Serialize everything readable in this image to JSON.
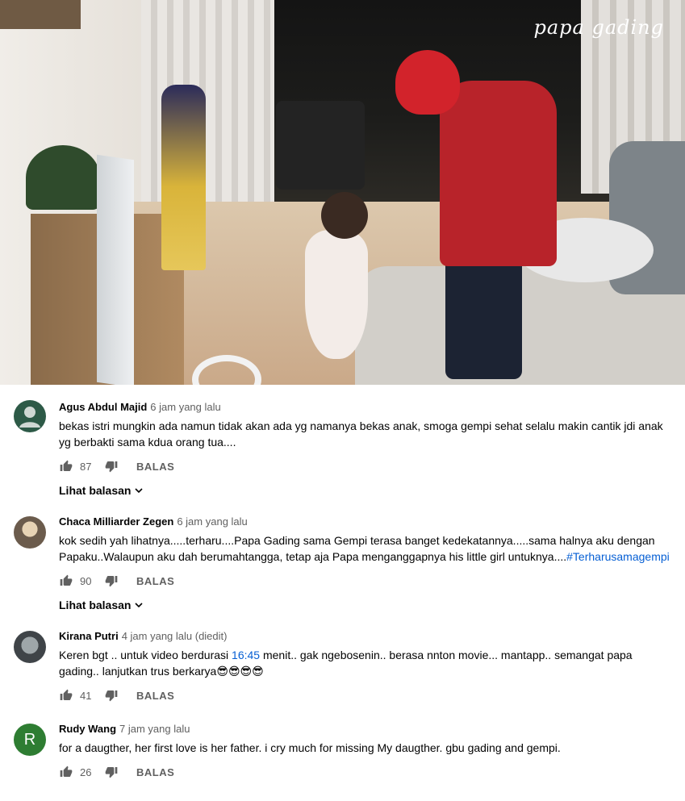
{
  "video": {
    "watermark": "papa gading"
  },
  "comments": [
    {
      "author": "Agus Abdul Majid",
      "time": "6 jam yang lalu",
      "avatar": "default-user-icon",
      "text_lines": [
        "bekas istri mungkin ada namun tidak akan ada yg namanya bekas anak, smoga gempi sehat selalu makin cantik jdi anak",
        "yg berbakti sama kdua orang tua...."
      ],
      "likes": "87",
      "reply_label": "BALAS",
      "replies_label": "Lihat balasan"
    },
    {
      "author": "Chaca Milliarder Zegen",
      "time": "6 jam yang lalu",
      "avatar": "profile-photo",
      "text_line1": "kok sedih yah lihatnya.....terharu....Papa Gading sama Gempi terasa banget kedekatannya.....sama halnya aku dengan",
      "text_line2_plain": "Papaku..Walaupun aku dah berumahtangga, tetap aja Papa menganggapnya his little girl untuknya....",
      "hashtag": "#Terharusamagempi",
      "likes": "90",
      "reply_label": "BALAS",
      "replies_label": "Lihat balasan"
    },
    {
      "author": "Kirana Putri",
      "time": "4 jam yang lalu (diedit)",
      "avatar": "profile-photo",
      "text_pre": "Keren bgt .. untuk video berdurasi ",
      "timestamp_link": "16:45",
      "text_post": " menit.. gak ngebosenin.. berasa nnton movie... mantapp.. semangat papa",
      "text_line2": "gading.. lanjutkan trus berkarya",
      "emoji": "😎😎😎😎",
      "likes": "41",
      "reply_label": "BALAS"
    },
    {
      "author": "Rudy Wang",
      "time": "7 jam yang lalu",
      "avatar_letter": "R",
      "text": "for a daugther, her first love is her father. i cry much for missing My daugther. gbu gading and gempi.",
      "likes": "26",
      "reply_label": "BALAS"
    }
  ],
  "icons": {
    "like": "thumbs-up-icon",
    "dislike": "thumbs-down-icon",
    "expand": "chevron-down-icon"
  },
  "colors": {
    "link": "#065fd4",
    "secondary_text": "#606060",
    "primary_text": "#030303"
  }
}
